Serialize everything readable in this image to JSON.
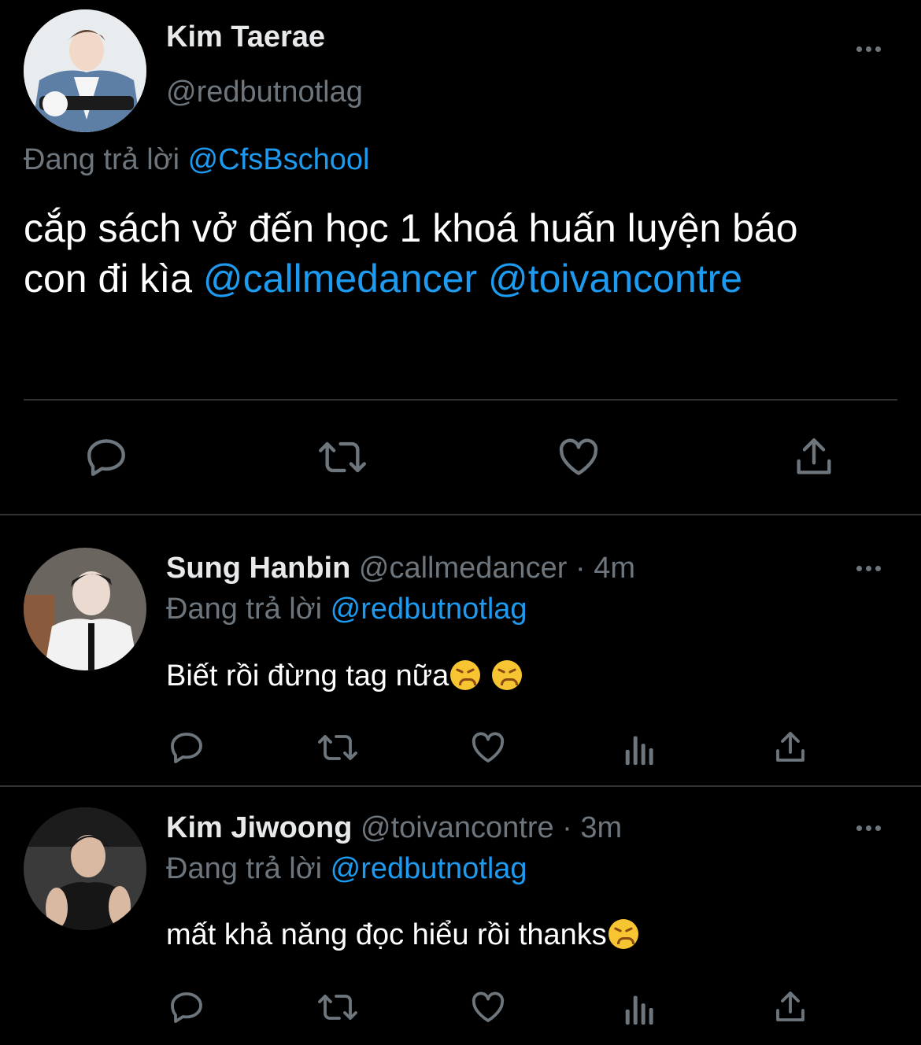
{
  "main_tweet": {
    "display_name": "Kim Taerae",
    "handle": "@redbutnotlag",
    "replying_prefix": "Đang trả lời",
    "replying_to": "@CfsBschool",
    "text_line1": "cắp sách vở đến học 1 khoá huấn luyện báo",
    "text_line2": "con đi kìa",
    "mention1": "@callmedancer",
    "mention2": "@toivancontre"
  },
  "replies": [
    {
      "display_name": "Sung Hanbin",
      "handle": "@callmedancer",
      "separator": "·",
      "time": "4m",
      "replying_prefix": "Đang trả lời",
      "replying_to": "@redbutnotlag",
      "text": "Biết rồi đừng tag nữa",
      "emojis": [
        "persevering-face-emoji",
        "persevering-face-emoji"
      ]
    },
    {
      "display_name": "Kim Jiwoong",
      "handle": "@toivancontre",
      "separator": "·",
      "time": "3m",
      "replying_prefix": "Đang trả lời",
      "replying_to": "@redbutnotlag",
      "text": "mất khả năng đọc hiểu rồi thanks",
      "emojis": [
        "weary-face-emoji"
      ]
    }
  ],
  "icons": {
    "reply": "reply-icon",
    "retweet": "retweet-icon",
    "like": "heart-icon",
    "analytics": "analytics-icon",
    "share": "share-icon",
    "more": "more-icon"
  },
  "colors": {
    "background": "#000000",
    "text": "#e7e9ea",
    "secondary": "#6e767d",
    "link": "#1d9bf0",
    "divider": "#2f3336"
  }
}
